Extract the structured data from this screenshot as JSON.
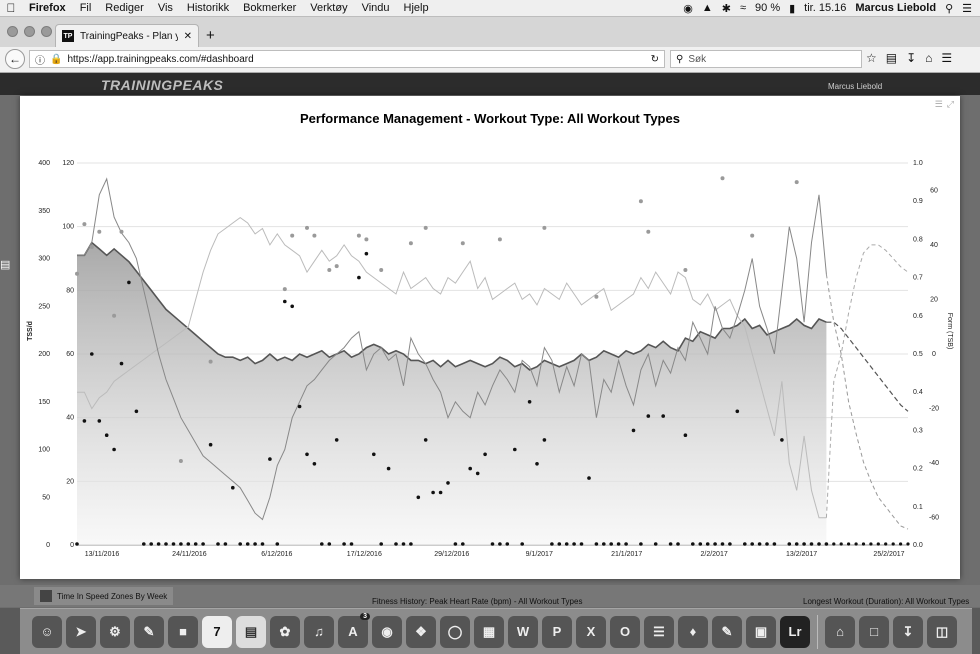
{
  "menubar": {
    "app": "Firefox",
    "items": [
      "Fil",
      "Rediger",
      "Vis",
      "Historikk",
      "Bokmerker",
      "Verktøy",
      "Vindu",
      "Hjelp"
    ],
    "battery": "90 %",
    "clock": "tir. 15.16",
    "user": "Marcus Liebold"
  },
  "browser": {
    "tab_title": "TrainingPeaks - Plan your tr...",
    "favicon_text": "TP",
    "url": "https://app.trainingpeaks.com/#dashboard",
    "search_placeholder": "Søk"
  },
  "site": {
    "logo": "TRAININGPEAKS",
    "user": "Marcus Liebold"
  },
  "chart_data": {
    "type": "line",
    "title": "Performance Management - Workout Type: All Workout Types",
    "ylabel_left": "TSS/d",
    "ylabel_right": "Form (TSB)",
    "x_tick_labels": [
      "13/11/2016",
      "24/11/2016",
      "6/12/2016",
      "17/12/2016",
      "29/12/2016",
      "9/1/2017",
      "21/1/2017",
      "2/2/2017",
      "13/2/2017",
      "25/2/2017"
    ],
    "y_axes": {
      "tss": {
        "ticks": [
          0,
          50,
          100,
          150,
          200,
          250,
          300,
          350,
          400
        ],
        "range": [
          0,
          400
        ]
      },
      "fitness": {
        "ticks": [
          0,
          20,
          40,
          60,
          80,
          100,
          120
        ],
        "range": [
          0,
          120
        ]
      },
      "intensity": {
        "ticks": [
          "0.0",
          "0.1",
          "0.2",
          "0.3",
          "0.4",
          "0.5",
          "0.6",
          "0.7",
          "0.8",
          "0.9",
          "1.0"
        ],
        "range": [
          0,
          1
        ]
      },
      "form": {
        "ticks": [
          -60,
          -40,
          -20,
          0,
          20,
          40,
          60
        ],
        "range": [
          -70,
          70
        ]
      }
    },
    "fitness": [
      91,
      91,
      95,
      93,
      91,
      93,
      91,
      89,
      86,
      83,
      80,
      77,
      74,
      72,
      70,
      68,
      66,
      64,
      62,
      60,
      59,
      59,
      58,
      59,
      57,
      58,
      60,
      58,
      59,
      58,
      60,
      59,
      60,
      61,
      59,
      60,
      61,
      59,
      60,
      62,
      63,
      62,
      60,
      61,
      60,
      58,
      58,
      57,
      58,
      56,
      58,
      56,
      57,
      58,
      57,
      56,
      57,
      59,
      58,
      56,
      57,
      55,
      56,
      58,
      57,
      56,
      57,
      58,
      60,
      58,
      59,
      61,
      60,
      59,
      61,
      60,
      61,
      63,
      62,
      64,
      62,
      61,
      65,
      64,
      67,
      66,
      65,
      68,
      68,
      69,
      71,
      68,
      69,
      66,
      67,
      68,
      69,
      71,
      69,
      68,
      71,
      70
    ],
    "fitness_projected": [
      70,
      68,
      65,
      62,
      59,
      56,
      53,
      50,
      47,
      44,
      42
    ],
    "fatigue": [
      91,
      91,
      95,
      110,
      115,
      103,
      98,
      95,
      90,
      80,
      70,
      60,
      52,
      46,
      40,
      36,
      32,
      28,
      26,
      24,
      22,
      20,
      18,
      14,
      10,
      8,
      15,
      25,
      30,
      40,
      45,
      50,
      52,
      55,
      58,
      60,
      62,
      65,
      67,
      55,
      60,
      62,
      58,
      60,
      50,
      65,
      60,
      57,
      52,
      48,
      40,
      45,
      42,
      40,
      48,
      44,
      50,
      55,
      52,
      48,
      58,
      56,
      50,
      62,
      58,
      48,
      56,
      50,
      60,
      58,
      40,
      52,
      48,
      58,
      50,
      44,
      55,
      60,
      50,
      58,
      54,
      62,
      58,
      70,
      65,
      60,
      75,
      68,
      65,
      72,
      80,
      90,
      75,
      68,
      60,
      80,
      100,
      90,
      70,
      95,
      110,
      85
    ],
    "fatigue_projected": [
      70,
      60,
      45,
      35,
      26,
      20,
      15,
      12,
      9,
      6,
      5
    ],
    "form": [
      -14,
      -14,
      -20,
      -16,
      -14,
      -10,
      -8,
      -6,
      -4,
      -2,
      0,
      2,
      4,
      6,
      8,
      10,
      20,
      30,
      38,
      44,
      46,
      48,
      50,
      48,
      44,
      46,
      40,
      44,
      40,
      38,
      36,
      30,
      34,
      38,
      34,
      36,
      40,
      36,
      34,
      30,
      28,
      26,
      24,
      22,
      30,
      24,
      26,
      28,
      24,
      22,
      28,
      26,
      30,
      34,
      24,
      28,
      20,
      22,
      24,
      26,
      20,
      22,
      18,
      24,
      22,
      20,
      26,
      22,
      18,
      20,
      22,
      24,
      16,
      18,
      20,
      22,
      28,
      24,
      30,
      26,
      22,
      30,
      28,
      20,
      18,
      22,
      16,
      18,
      20,
      14,
      10,
      0,
      -10,
      -20,
      -30,
      -10,
      -40,
      -50,
      -30,
      -50,
      -60,
      -60
    ],
    "form_projected": [
      -10,
      0,
      15,
      28,
      37,
      40,
      40,
      38,
      35,
      32,
      30
    ],
    "tss_points": [
      0,
      130,
      200,
      130,
      115,
      100,
      190,
      275,
      140,
      0,
      0,
      0,
      0,
      0,
      0,
      0,
      0,
      0,
      105,
      0,
      0,
      60,
      0,
      0,
      0,
      0,
      90,
      0,
      255,
      250,
      145,
      95,
      85,
      0,
      0,
      110,
      0,
      0,
      280,
      305,
      95,
      0,
      80,
      0,
      0,
      0,
      50,
      110,
      55,
      55,
      65,
      0,
      0,
      80,
      75,
      95,
      0,
      0,
      0,
      100,
      0,
      150,
      85,
      110,
      0,
      0,
      0,
      0,
      0,
      70,
      0,
      0,
      0,
      0,
      0,
      120,
      0,
      135,
      0,
      135,
      0,
      0,
      115,
      0,
      0,
      0,
      0,
      0,
      0,
      140,
      0,
      0,
      0,
      0,
      0,
      110,
      0,
      0,
      0,
      0,
      0,
      0
    ],
    "if_points": [
      0.71,
      0.84,
      0.78,
      0.82,
      0.0,
      0.6,
      0.82,
      0.0,
      0.0,
      0.0,
      0.0,
      0.0,
      0.0,
      0.0,
      0.22,
      0.0,
      0.0,
      0.0,
      0.48,
      0.0,
      0.0,
      0.0,
      0.0,
      0.0,
      0.0,
      0.0,
      0.0,
      0.0,
      0.67,
      0.81,
      0.0,
      0.83,
      0.81,
      0.0,
      0.72,
      0.73,
      0.0,
      0.0,
      0.81,
      0.8,
      0.0,
      0.72,
      0.0,
      0.0,
      0.0,
      0.79,
      0.0,
      0.83,
      0.0,
      0.0,
      0.0,
      0.0,
      0.79,
      0.0,
      0.0,
      0.0,
      0.0,
      0.8,
      0.0,
      0.0,
      0.0,
      0.0,
      0.0,
      0.83,
      0.0,
      0.0,
      0.0,
      0.0,
      0.0,
      0.0,
      0.65,
      0.0,
      0.0,
      0.0,
      0.0,
      0.0,
      0.9,
      0.82,
      0.0,
      0.0,
      0.0,
      0.0,
      0.72,
      0.0,
      0.0,
      0.0,
      0.0,
      0.96,
      0.0,
      0.0,
      0.0,
      0.81,
      0.0,
      0.0,
      0.0,
      0.0,
      0.0,
      0.95,
      0.0,
      0.0,
      0.0,
      0.0
    ]
  },
  "footer": {
    "left_widget": "Time In Speed Zones By Week",
    "center_widget": "Fitness History: Peak Heart Rate (bpm) - All Workout Types",
    "right_widget": "Longest Workout (Duration): All Workout Types"
  },
  "dock": {
    "calendar_day": "7",
    "badge": "3",
    "lightroom": "Lr"
  }
}
